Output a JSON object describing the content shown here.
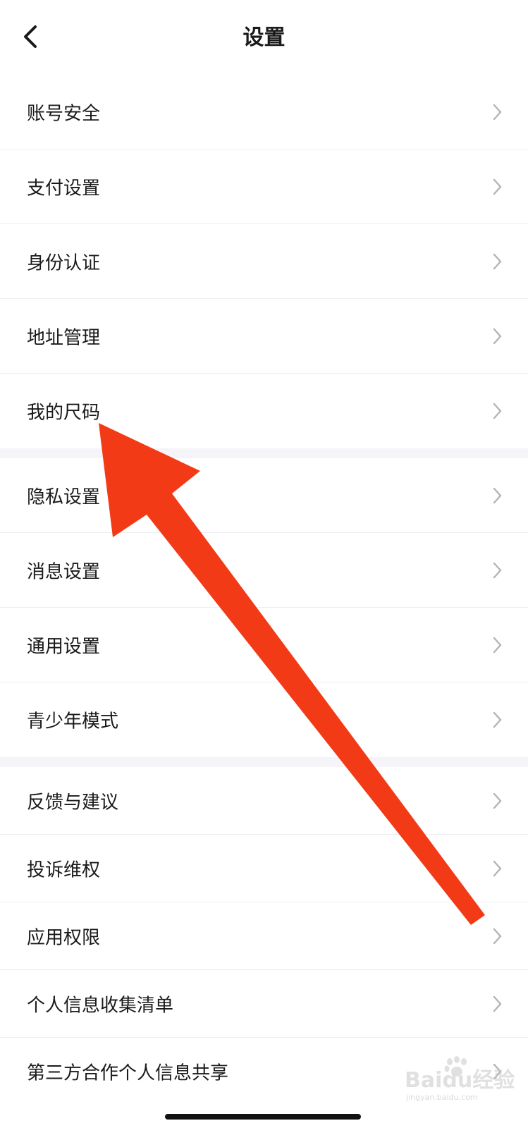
{
  "header": {
    "title": "设置",
    "back_icon": "chevron-left-icon"
  },
  "groups": [
    {
      "items": [
        {
          "label": "账号安全",
          "icon": "chevron-right-icon"
        },
        {
          "label": "支付设置",
          "icon": "chevron-right-icon"
        },
        {
          "label": "身份认证",
          "icon": "chevron-right-icon"
        },
        {
          "label": "地址管理",
          "icon": "chevron-right-icon"
        },
        {
          "label": "我的尺码",
          "icon": "chevron-right-icon"
        }
      ]
    },
    {
      "items": [
        {
          "label": "隐私设置",
          "icon": "chevron-right-icon"
        },
        {
          "label": "消息设置",
          "icon": "chevron-right-icon"
        },
        {
          "label": "通用设置",
          "icon": "chevron-right-icon"
        },
        {
          "label": "青少年模式",
          "icon": "chevron-right-icon"
        }
      ]
    },
    {
      "items": [
        {
          "label": "反馈与建议",
          "icon": "chevron-right-icon"
        },
        {
          "label": "投诉维权",
          "icon": "chevron-right-icon"
        },
        {
          "label": "应用权限",
          "icon": "chevron-right-icon"
        },
        {
          "label": "个人信息收集清单",
          "icon": "chevron-right-icon"
        },
        {
          "label": "第三方合作个人信息共享",
          "icon": "chevron-right-icon"
        }
      ]
    }
  ],
  "annotation": {
    "color": "#f33a17",
    "icon": "arrow-annotation-icon"
  },
  "watermark": {
    "mark_text": "Baidu经验",
    "sub_text": "jingyan.baidu.com"
  },
  "colors": {
    "background": "#ffffff",
    "group_gap": "#f5f4f9",
    "divider": "#eeeef2",
    "chevron": "#b3b3b8"
  }
}
